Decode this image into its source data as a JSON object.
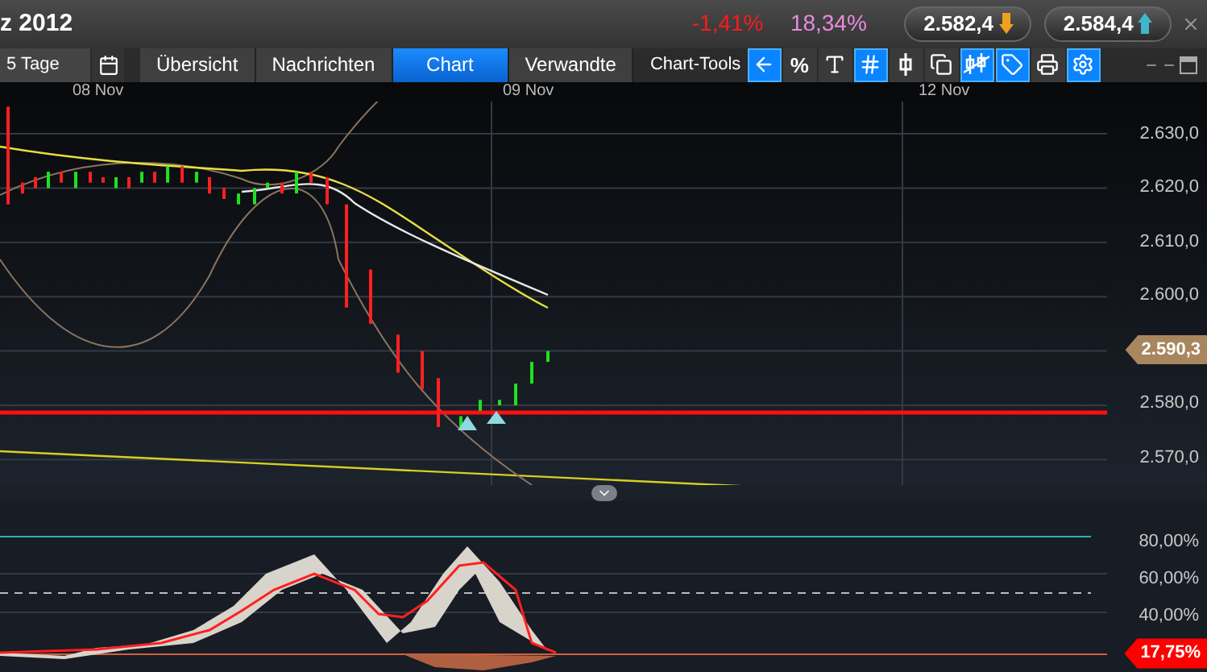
{
  "header": {
    "title": "z 2012",
    "change": "-1,41%",
    "volatility": "18,34%",
    "quotes": [
      {
        "value": "2.582,4",
        "kind": "down"
      },
      {
        "value": "2.584,4",
        "kind": "up"
      }
    ]
  },
  "toolbar": {
    "period": "5 Tage",
    "tabs": [
      {
        "label": "Übersicht",
        "selected": false
      },
      {
        "label": "Nachrichten",
        "selected": false
      },
      {
        "label": "Chart",
        "selected": true
      },
      {
        "label": "Verwandte",
        "selected": false
      }
    ],
    "tools_label": "Chart-Tools",
    "tools": [
      {
        "kind": "back",
        "on": true
      },
      {
        "kind": "percent",
        "label": "%",
        "on": false
      },
      {
        "kind": "text",
        "on": false
      },
      {
        "kind": "grid",
        "on": true
      },
      {
        "kind": "candle",
        "on": false
      },
      {
        "kind": "windows",
        "on": false
      },
      {
        "kind": "candles",
        "on": true
      },
      {
        "kind": "tag",
        "on": true
      },
      {
        "kind": "print",
        "on": false
      },
      {
        "kind": "settings",
        "on": true
      }
    ]
  },
  "price_pane": {
    "dates": [
      "08 Nov",
      "09 Nov",
      "12 Nov"
    ],
    "axis": [
      {
        "kind": "tick",
        "text": "2.630,0"
      },
      {
        "kind": "tick",
        "text": "2.620,0"
      },
      {
        "kind": "tick",
        "text": "2.610,0"
      },
      {
        "kind": "tick",
        "text": "2.600,0"
      },
      {
        "kind": "tag",
        "text": "2.590,3"
      },
      {
        "kind": "tick",
        "text": "2.580,0"
      },
      {
        "kind": "tick",
        "text": "2.570,0"
      }
    ]
  },
  "indicator_pane": {
    "axis": [
      {
        "kind": "tick",
        "text": "80,00%"
      },
      {
        "kind": "tick",
        "text": "60,00%"
      },
      {
        "kind": "tick",
        "text": "40,00%"
      },
      {
        "kind": "tag",
        "text": "17,75%"
      }
    ]
  }
}
